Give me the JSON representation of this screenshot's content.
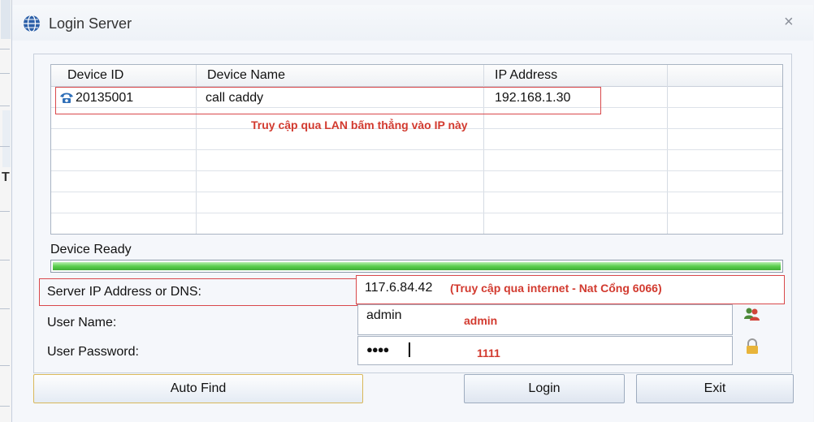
{
  "window": {
    "title": "Login Server",
    "close_glyph": "×"
  },
  "device_table": {
    "columns": [
      "Device ID",
      "Device Name",
      "IP Address"
    ],
    "rows": [
      {
        "device_id": "20135001",
        "device_name": "call caddy",
        "ip_address": "192.168.1.30",
        "icon": "phone-icon"
      }
    ]
  },
  "annotations": {
    "lan_note": "Truy cập qua LAN bấm thẳng vào IP này",
    "internet_note": "(Truy cập qua internet - Nat Cổng 6066)",
    "username_note": "admin",
    "password_note": "1111",
    "color": "#d23a2f"
  },
  "status": {
    "text": "Device Ready",
    "progress": 1.0,
    "progress_color": "#4cc241"
  },
  "form": {
    "server_label": "Server IP Address or DNS:",
    "server_value": "117.6.84.42",
    "username_label": "User Name:",
    "username_value": "admin",
    "password_label": "User Password:",
    "password_value": "●●●●"
  },
  "buttons": {
    "auto_find": "Auto Find",
    "login": "Login",
    "exit": "Exit"
  },
  "icons": {
    "users": "users-icon",
    "lock": "lock-icon",
    "app": "globe-icon"
  }
}
